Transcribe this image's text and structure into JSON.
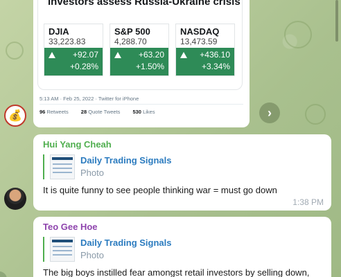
{
  "tweet": {
    "headline": "investors assess Russia-Ukraine crisis",
    "indices": [
      {
        "name": "DJIA",
        "value": "33,223.83",
        "change": "+92.07",
        "percent": "+0.28%"
      },
      {
        "name": "S&P 500",
        "value": "4,288.70",
        "change": "+63.20",
        "percent": "+1.50%"
      },
      {
        "name": "NASDAQ",
        "value": "13,473.59",
        "change": "+436.10",
        "percent": "+3.34%"
      }
    ],
    "meta": "5:13 AM · Feb 25, 2022 · Twitter for iPhone",
    "retweets_count": "96",
    "retweets_label": "Retweets",
    "quotes_count": "28",
    "quotes_label": "Quote Tweets",
    "likes_count": "530",
    "likes_label": "Likes"
  },
  "messages": [
    {
      "sender": "Hui Yang Cheah",
      "sender_color": "#4fae4e",
      "reply_title": "Daily Trading Signals",
      "reply_sub": "Photo",
      "text": "It is quite funny to see people thinking war = must go down",
      "time": "1:38 PM"
    },
    {
      "sender": "Teo Gee Hoe",
      "sender_color": "#8e44ad",
      "reply_title": "Daily Trading Signals",
      "reply_sub": "Photo",
      "text": "The big boys instilled fear amongst retail investors by selling down,"
    }
  ],
  "colors": {
    "index_green": "#2e8b57",
    "link_blue": "#2b7bbf"
  },
  "icons": {
    "forward": "chevron-right-icon",
    "bag_avatar": "money-bag-icon"
  }
}
